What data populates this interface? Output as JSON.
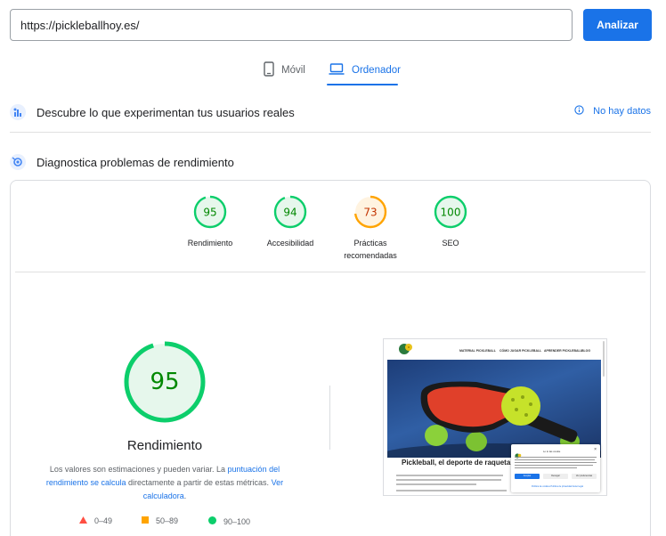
{
  "search": {
    "url_value": "https://pickleballhoy.es/",
    "analyze_label": "Analizar"
  },
  "tabs": [
    {
      "label": "Móvil",
      "icon": "phone-icon",
      "active": false
    },
    {
      "label": "Ordenador",
      "icon": "laptop-icon",
      "active": true
    }
  ],
  "field_data": {
    "title": "Descubre lo que experimentan tus usuarios reales",
    "icon": "users-chart-icon",
    "status": "No hay datos",
    "status_icon": "info-icon"
  },
  "diagnostics": {
    "title": "Diagnostica problemas de rendimiento",
    "icon": "lighthouse-icon"
  },
  "scores": [
    {
      "label": "Rendimiento",
      "value": "95",
      "fraction": 0.95,
      "color": "#0cce6b",
      "text_color": "#008800",
      "bg": "#e6f7ec"
    },
    {
      "label": "Accesibilidad",
      "value": "94",
      "fraction": 0.94,
      "color": "#0cce6b",
      "text_color": "#008800",
      "bg": "#e6f7ec"
    },
    {
      "label": "Prácticas recomendadas",
      "value": "73",
      "fraction": 0.73,
      "color": "#ffa400",
      "text_color": "#c33300",
      "bg": "#fff3e0"
    },
    {
      "label": "SEO",
      "value": "100",
      "fraction": 1.0,
      "color": "#0cce6b",
      "text_color": "#008800",
      "bg": "#e6f7ec"
    }
  ],
  "main_score": {
    "value": "95",
    "fraction": 0.95,
    "title": "Rendimiento",
    "note_prefix": "Los valores son estimaciones y pueden variar. La ",
    "note_link1": "puntuación del rendimiento se calcula",
    "note_middle": " directamente a partir de estas métricas. ",
    "note_link2": "Ver calculadora",
    "note_suffix": "."
  },
  "legend": [
    {
      "range": "0–49",
      "shape": "triangle",
      "color": "#ff4e42"
    },
    {
      "range": "50–89",
      "shape": "square",
      "color": "#ffa400"
    },
    {
      "range": "90–100",
      "shape": "circle",
      "color": "#0cce6b"
    }
  ],
  "screenshot": {
    "nav": [
      "MATERIAL PICKLEBALL",
      "CÓMO JUGAR PICKLEBALL",
      "APRENDER PICKLEBALL",
      "BLOG"
    ],
    "headline": "Pickleball, el deporte de raqueta",
    "cookie_title": "Lo lo las cookie",
    "cookie_accept": "Aceptar",
    "cookie_deny": "Denegar",
    "cookie_prefs": "Ver preferencias",
    "cookie_links": "Política de cookies   Política de privacidad   Aviso legal"
  },
  "colors": {
    "accent": "#1a73e8",
    "pass": "#0cce6b",
    "average": "#ffa400",
    "fail": "#ff4e42"
  }
}
